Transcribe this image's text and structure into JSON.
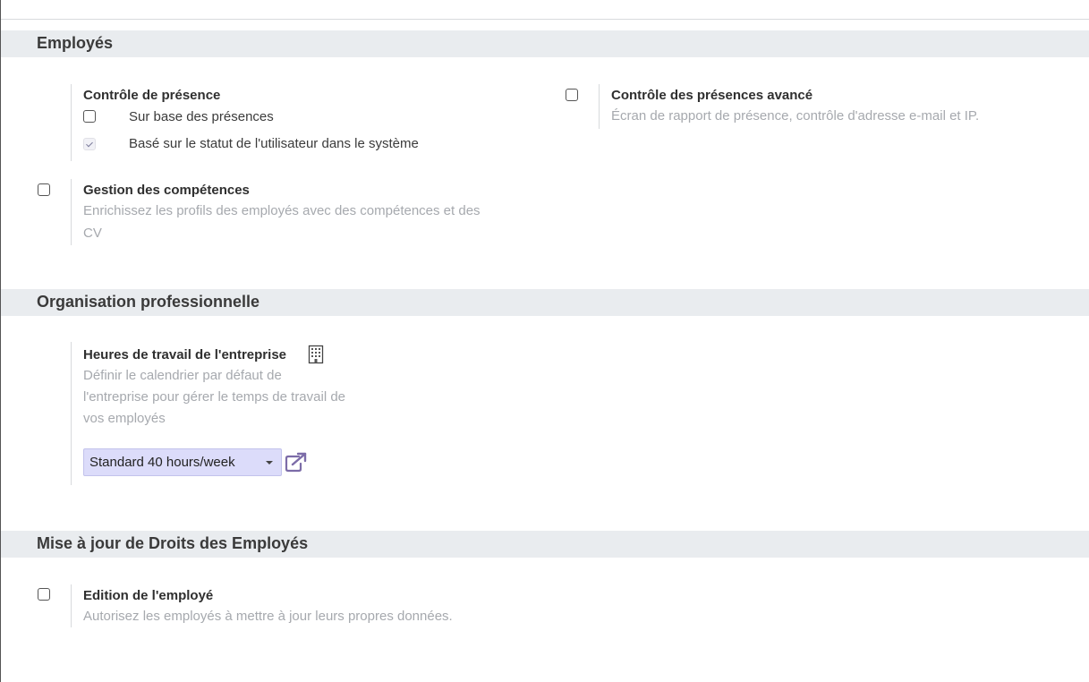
{
  "sections": [
    {
      "title": "Employés"
    },
    {
      "title": "Organisation professionnelle"
    },
    {
      "title": "Mise à jour de Droits des Employés"
    }
  ],
  "employees": {
    "attendance_control": {
      "title": "Contrôle de présence",
      "options": [
        {
          "label": "Sur base des présences",
          "checked": false
        },
        {
          "label": "Basé sur le statut de l'utilisateur dans le système",
          "checked": true,
          "disabled": true
        }
      ]
    },
    "advanced_attendance": {
      "title": "Contrôle des présences avancé",
      "description": "Écran de rapport de présence, contrôle d'adresse e-mail et IP.",
      "checked": false
    },
    "skills": {
      "title": "Gestion des compétences",
      "description_line1": "Enrichissez les profils des employés avec des compétences et des",
      "description_line2": "CV",
      "checked": false
    }
  },
  "work_organization": {
    "working_hours": {
      "title": "Heures de travail de l'entreprise",
      "title_icon": "building-icon",
      "description_line1": "Définir le calendrier par défaut de",
      "description_line2": "l'entreprise pour gérer le temps de travail de",
      "description_line3": "vos employés",
      "select_value": "Standard 40 hours/week",
      "external_link_icon": "external-link-icon"
    }
  },
  "rights_update": {
    "employee_editing": {
      "title": "Edition de l'employé",
      "description": "Autorisez les employés à mettre à jour leurs propres données.",
      "checked": false
    }
  },
  "colors": {
    "section_header_bg": "#e9ecef",
    "select_bg": "#dcdcfa",
    "accent": "#7c6ca8",
    "muted_text": "#a6a9ae"
  }
}
